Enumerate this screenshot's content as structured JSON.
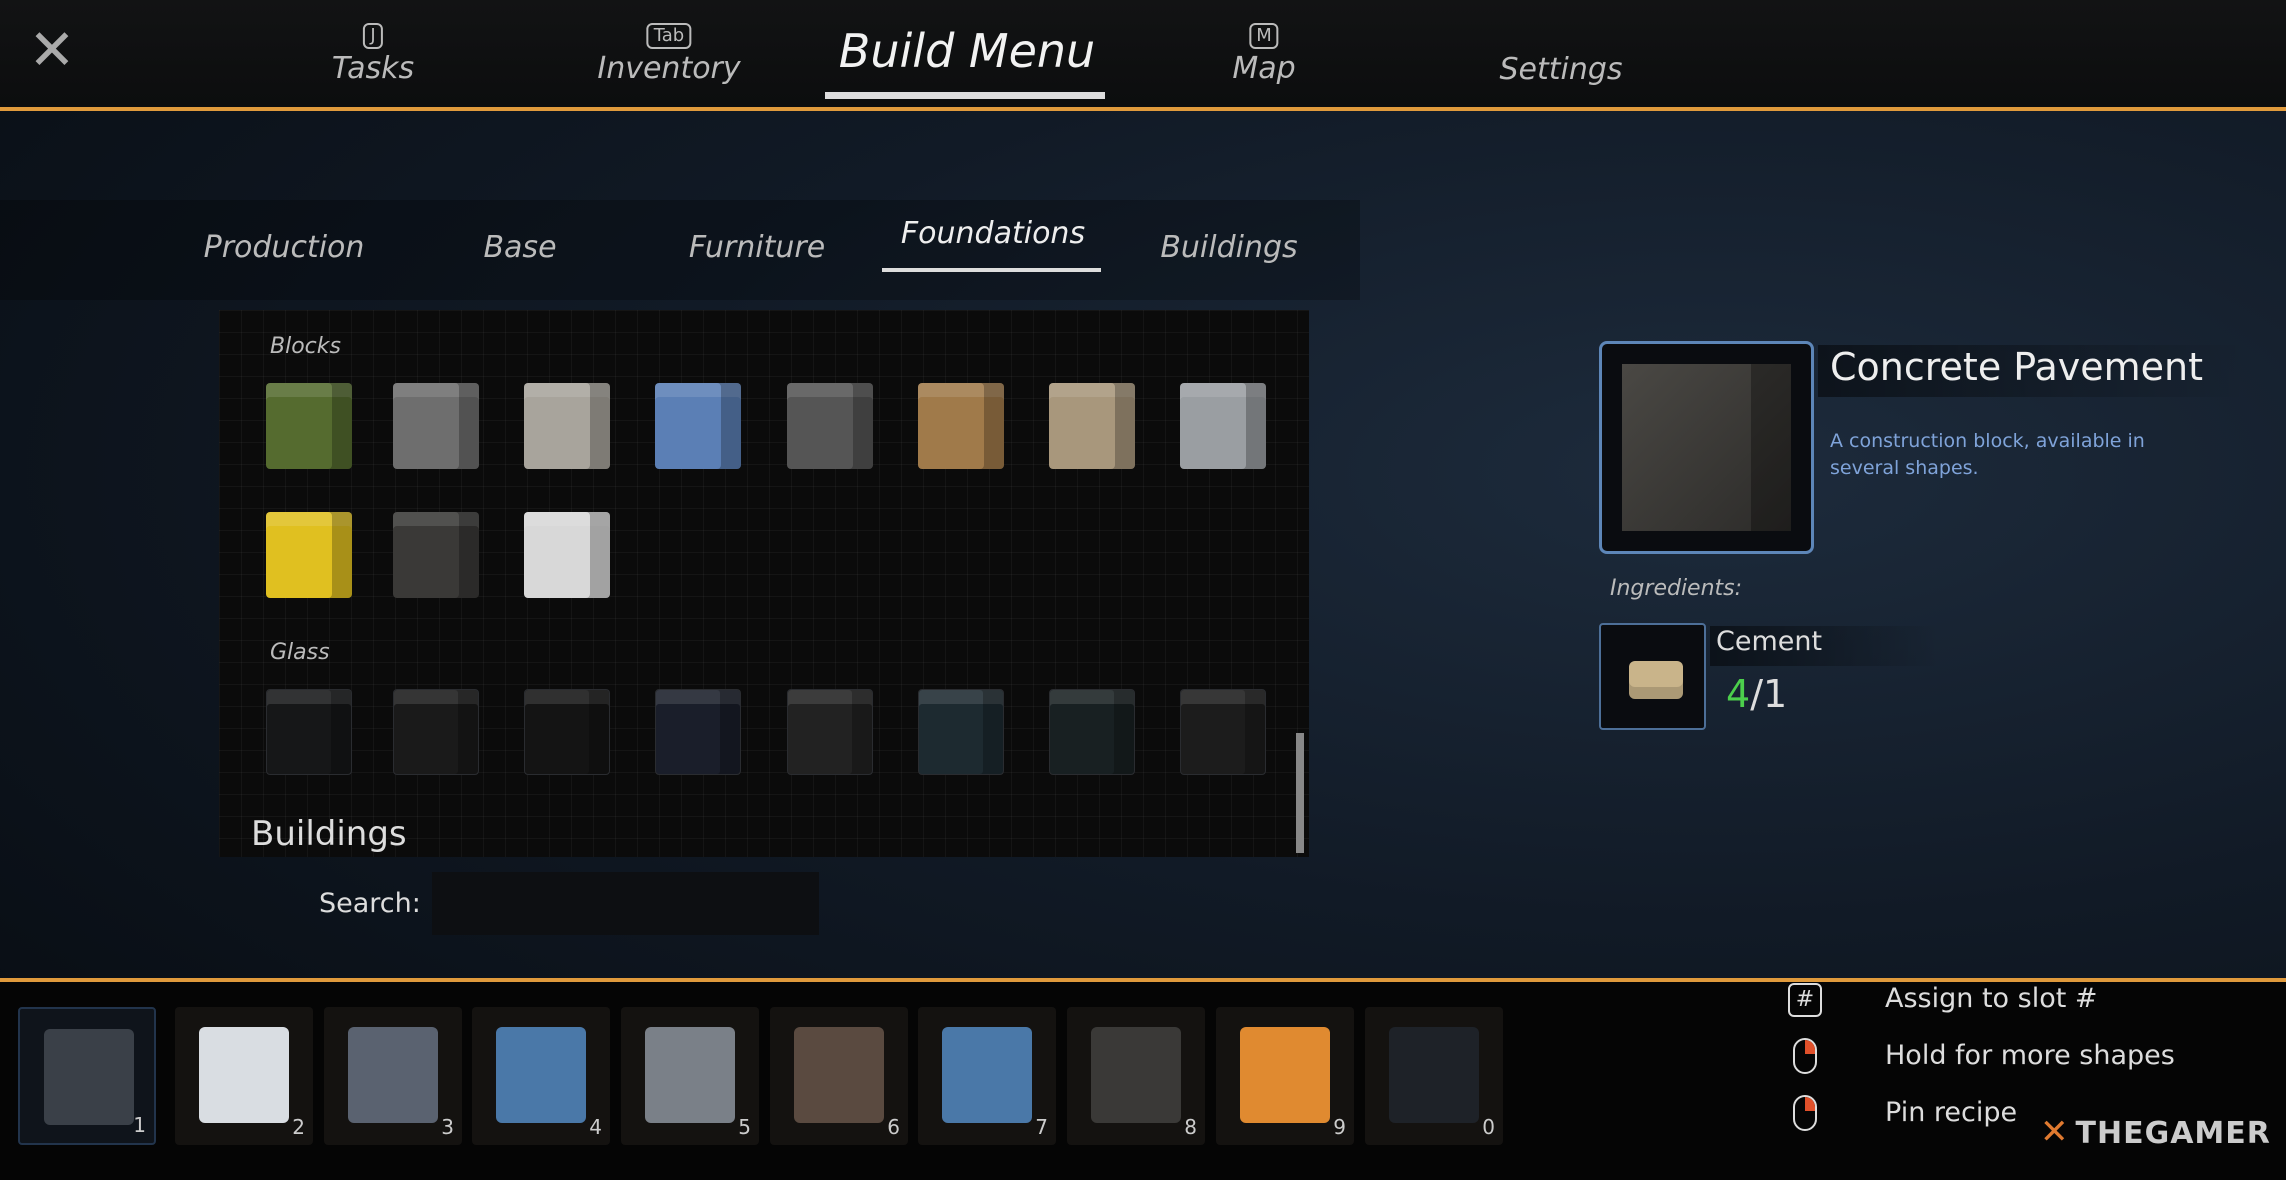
{
  "nav": {
    "close_icon": "close-x-icon",
    "tabs": [
      {
        "label": "Tasks",
        "key": "J"
      },
      {
        "label": "Inventory",
        "key": "Tab"
      },
      {
        "label": "Build Menu",
        "key": ""
      },
      {
        "label": "Map",
        "key": "M"
      },
      {
        "label": "Settings",
        "key": ""
      }
    ],
    "active": "Build Menu"
  },
  "subtabs": {
    "items": [
      "Production",
      "Base",
      "Furniture",
      "Foundations",
      "Buildings"
    ],
    "active": "Foundations"
  },
  "grid": {
    "sections": [
      {
        "label": "Blocks",
        "items": [
          {
            "color": "#556b2f"
          },
          {
            "color": "#6e6e6e"
          },
          {
            "color": "#a8a49c"
          },
          {
            "color": "#5b7fb5"
          },
          {
            "color": "#555555"
          },
          {
            "color": "#a07a4a"
          },
          {
            "color": "#a8977c"
          },
          {
            "color": "#9a9ea2"
          },
          {
            "color": "#e0c020"
          },
          {
            "color": "#3a3937"
          },
          {
            "color": "#d8d8d8"
          }
        ]
      },
      {
        "label": "Glass",
        "items": [
          {
            "color": "#161718"
          },
          {
            "color": "#1a1a1a"
          },
          {
            "color": "#141414"
          },
          {
            "color": "#1a1e2a"
          },
          {
            "color": "#222222"
          },
          {
            "color": "#1d2a30"
          },
          {
            "color": "#182022"
          },
          {
            "color": "#1c1c1c"
          }
        ]
      }
    ]
  },
  "buildings_heading": "Buildings",
  "search": {
    "label": "Search:",
    "value": "",
    "placeholder": ""
  },
  "detail": {
    "title": "Concrete Pavement",
    "description": "A construction block, available in several shapes.",
    "ingredients_label": "Ingredients:",
    "ingredients": [
      {
        "name": "Cement",
        "have": "4",
        "need": "/1"
      }
    ]
  },
  "hotbar": {
    "slots": [
      {
        "num": "1",
        "color": "#3a4048"
      },
      {
        "num": "2",
        "color": "#d9dde2"
      },
      {
        "num": "3",
        "color": "#5a6270"
      },
      {
        "num": "4",
        "color": "#4a78a8"
      },
      {
        "num": "5",
        "color": "#7a8088"
      },
      {
        "num": "6",
        "color": "#5a4a40"
      },
      {
        "num": "7",
        "color": "#4a78a8"
      },
      {
        "num": "8",
        "color": "#3a3937"
      },
      {
        "num": "9",
        "color": "#e08a30"
      },
      {
        "num": "0",
        "color": "#1e2228"
      }
    ],
    "selected": "1"
  },
  "hints": [
    {
      "icon": "hash-key-icon",
      "glyph": "#",
      "label": "Assign to slot #"
    },
    {
      "icon": "mouse-right-icon",
      "label": "Hold for more shapes"
    },
    {
      "icon": "mouse-right-icon",
      "label": "Pin recipe"
    }
  ],
  "watermark": "THEGAMER",
  "colors": {
    "accent": "#e09a3c",
    "description": "#7fa3d9",
    "have": "#4ccf4c",
    "selected_border": "#5d86b8"
  }
}
